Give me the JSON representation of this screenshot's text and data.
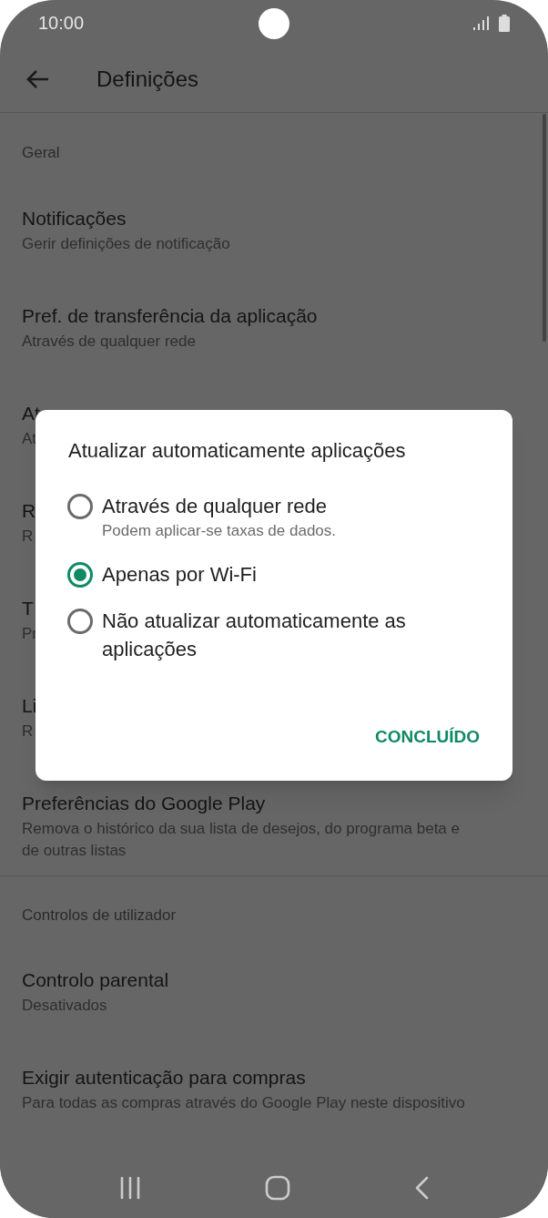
{
  "status_bar": {
    "time": "10:00"
  },
  "toolbar": {
    "title": "Definições"
  },
  "sections": [
    {
      "header": "Geral",
      "items": [
        {
          "title": "Notificações",
          "subtitle": "Gerir definições de notificação"
        },
        {
          "title": "Pref. de transferência da aplicação",
          "subtitle": "Através de qualquer rede"
        },
        {
          "title": "At",
          "subtitle": "At"
        },
        {
          "title": "R",
          "subtitle": "R"
        },
        {
          "title": "T",
          "subtitle": "Pr"
        },
        {
          "title": "Li",
          "subtitle": "R"
        },
        {
          "title": "Preferências do Google Play",
          "subtitle": "Remova o histórico da sua lista de desejos, do programa beta e de outras listas"
        }
      ]
    },
    {
      "header": "Controlos de utilizador",
      "items": [
        {
          "title": "Controlo parental",
          "subtitle": "Desativados"
        },
        {
          "title": "Exigir autenticação para compras",
          "subtitle": "Para todas as compras através do Google Play neste dispositivo"
        }
      ]
    }
  ],
  "dialog": {
    "title": "Atualizar automaticamente aplicações",
    "options": [
      {
        "label": "Através de qualquer rede",
        "hint": "Podem aplicar-se taxas de dados.",
        "selected": false
      },
      {
        "label": "Apenas por Wi-Fi",
        "selected": true
      },
      {
        "label": "Não atualizar automaticamente as aplicações",
        "selected": false
      }
    ],
    "button": "CONCLUÍDO"
  }
}
